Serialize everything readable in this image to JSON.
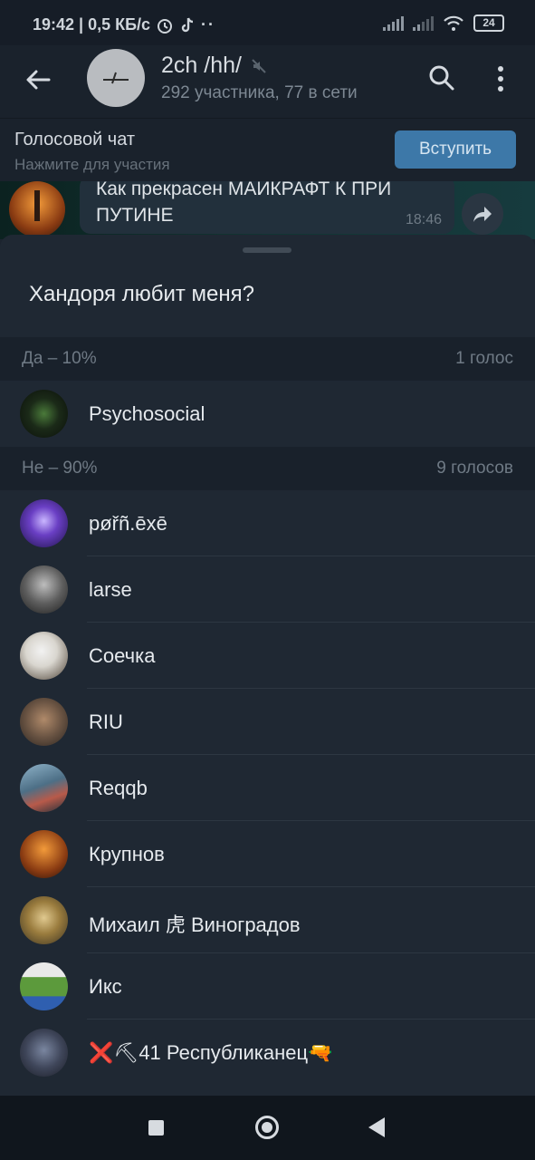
{
  "status_bar": {
    "time_speed": "19:42 | 0,5 КБ/с",
    "battery": "24"
  },
  "header": {
    "title": "2ch /hh/",
    "subtitle": "292 участника, 77 в сети"
  },
  "voice_chat": {
    "title": "Голосовой чат",
    "subtitle": "Нажмите для участия",
    "join_label": "Вступить"
  },
  "message": {
    "text": "Как прекрасен МАЙКРАФТ К ПРИ ПУТИНЕ",
    "time": "18:46"
  },
  "poll": {
    "question": "Хандоря любит меня?",
    "options": [
      {
        "label": "Да – 10%",
        "count": "1 голос",
        "voters": [
          "Psychosocial"
        ]
      },
      {
        "label": "Не – 90%",
        "count": "9 голосов",
        "voters": [
          "pøřñ.ēxē",
          "larse",
          "Соечка",
          "RIU",
          "Reqqb",
          "Крупнов",
          "Михаил 虎 Виноградов",
          "Икс",
          "❌⛏41 Республиканец🔫"
        ]
      }
    ]
  },
  "colors": {
    "accent_button": "#3d78a8",
    "sheet_bg": "#1f2833",
    "section_bg": "#19212b"
  }
}
